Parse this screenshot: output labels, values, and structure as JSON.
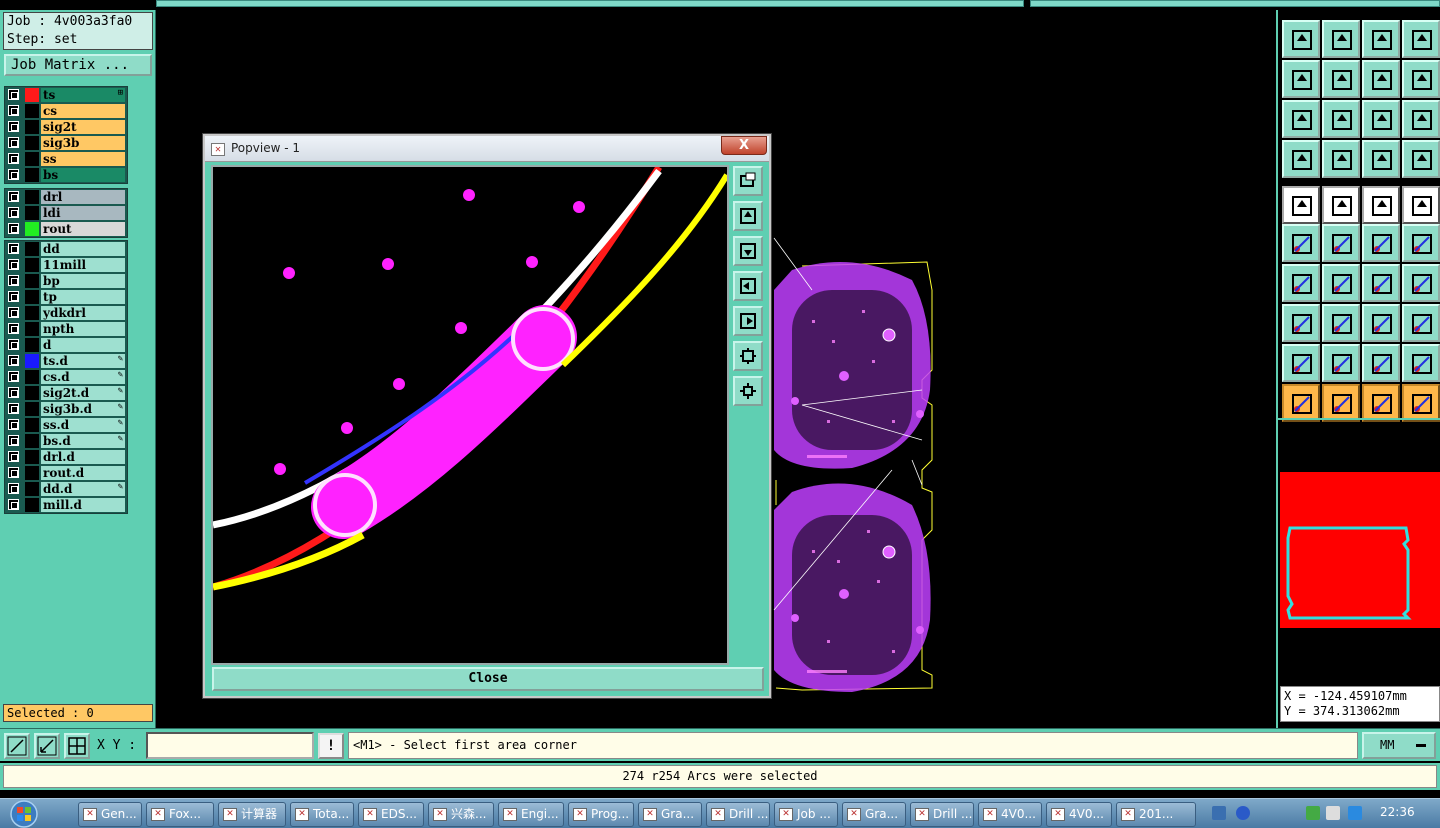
{
  "job": {
    "job_line": "Job : 4v003a3fa0",
    "step_line": "Step: set",
    "matrix_button": "Job Matrix ..."
  },
  "layers_board": [
    {
      "name": "ts",
      "color": "#1a8a66",
      "swatch": "#ff1a1a",
      "mark": "⊞"
    },
    {
      "name": "cs",
      "color": "#ffc864",
      "swatch": "#000000",
      "mark": ""
    },
    {
      "name": "sig2t",
      "color": "#ffc864",
      "swatch": "#000000",
      "mark": ""
    },
    {
      "name": "sig3b",
      "color": "#ffc864",
      "swatch": "#000000",
      "mark": ""
    },
    {
      "name": "ss",
      "color": "#ffc864",
      "swatch": "#000000",
      "mark": ""
    },
    {
      "name": "bs",
      "color": "#1a8a66",
      "swatch": "#000000",
      "mark": ""
    }
  ],
  "layers_drill": [
    {
      "name": "drl",
      "color": "#a8b8c0",
      "swatch": "#000000",
      "mark": ""
    },
    {
      "name": "ldi",
      "color": "#a8b8c0",
      "swatch": "#000000",
      "mark": ""
    },
    {
      "name": "rout",
      "color": "#d8d8d8",
      "swatch": "#22ee22",
      "mark": ""
    }
  ],
  "layers_misc": [
    {
      "name": "dd",
      "color": "#9ee0d0",
      "swatch": "#000000",
      "mark": ""
    },
    {
      "name": "11mill",
      "color": "#9ee0d0",
      "swatch": "#000000",
      "mark": ""
    },
    {
      "name": "bp",
      "color": "#9ee0d0",
      "swatch": "#000000",
      "mark": ""
    },
    {
      "name": "tp",
      "color": "#9ee0d0",
      "swatch": "#000000",
      "mark": ""
    },
    {
      "name": "ydkdrl",
      "color": "#9ee0d0",
      "swatch": "#000000",
      "mark": ""
    },
    {
      "name": "npth",
      "color": "#9ee0d0",
      "swatch": "#000000",
      "mark": ""
    },
    {
      "name": "d",
      "color": "#9ee0d0",
      "swatch": "#000000",
      "mark": ""
    },
    {
      "name": "ts.d",
      "color": "#9ee0d0",
      "swatch": "#1a1aff",
      "mark": "✎"
    },
    {
      "name": "cs.d",
      "color": "#9ee0d0",
      "swatch": "#000000",
      "mark": "✎"
    },
    {
      "name": "sig2t.d",
      "color": "#9ee0d0",
      "swatch": "#000000",
      "mark": "✎"
    },
    {
      "name": "sig3b.d",
      "color": "#9ee0d0",
      "swatch": "#000000",
      "mark": "✎"
    },
    {
      "name": "ss.d",
      "color": "#9ee0d0",
      "swatch": "#000000",
      "mark": "✎"
    },
    {
      "name": "bs.d",
      "color": "#9ee0d0",
      "swatch": "#000000",
      "mark": "✎"
    },
    {
      "name": "drl.d",
      "color": "#9ee0d0",
      "swatch": "#000000",
      "mark": ""
    },
    {
      "name": "rout.d",
      "color": "#9ee0d0",
      "swatch": "#000000",
      "mark": ""
    },
    {
      "name": "dd.d",
      "color": "#9ee0d0",
      "swatch": "#000000",
      "mark": "✎"
    },
    {
      "name": "mill.d",
      "color": "#9ee0d0",
      "swatch": "#000000",
      "mark": ""
    }
  ],
  "selected_text": "Selected : 0",
  "popview": {
    "title": "Popview - 1",
    "close_x": "X",
    "close_button": "Close"
  },
  "coords": {
    "x_line": "X = -124.459107mm",
    "y_line": "Y = 374.313062mm"
  },
  "cmd": {
    "xy_label": "X Y :",
    "xy_value": "",
    "bang": "!",
    "prompt": "<M1> - Select first area corner",
    "units": "MM"
  },
  "status_message": "274 r254 Arcs were selected",
  "taskbar": {
    "tasks": [
      "Gen...",
      "Fox...",
      "计算器",
      "Tota...",
      "EDS...",
      "兴森...",
      "Engi...",
      "Prog...",
      "Gra...",
      "Drill ...",
      "Job ...",
      "Gra...",
      "Drill ...",
      "4V0...",
      "4V0...",
      "201..."
    ],
    "time": "22:36"
  }
}
